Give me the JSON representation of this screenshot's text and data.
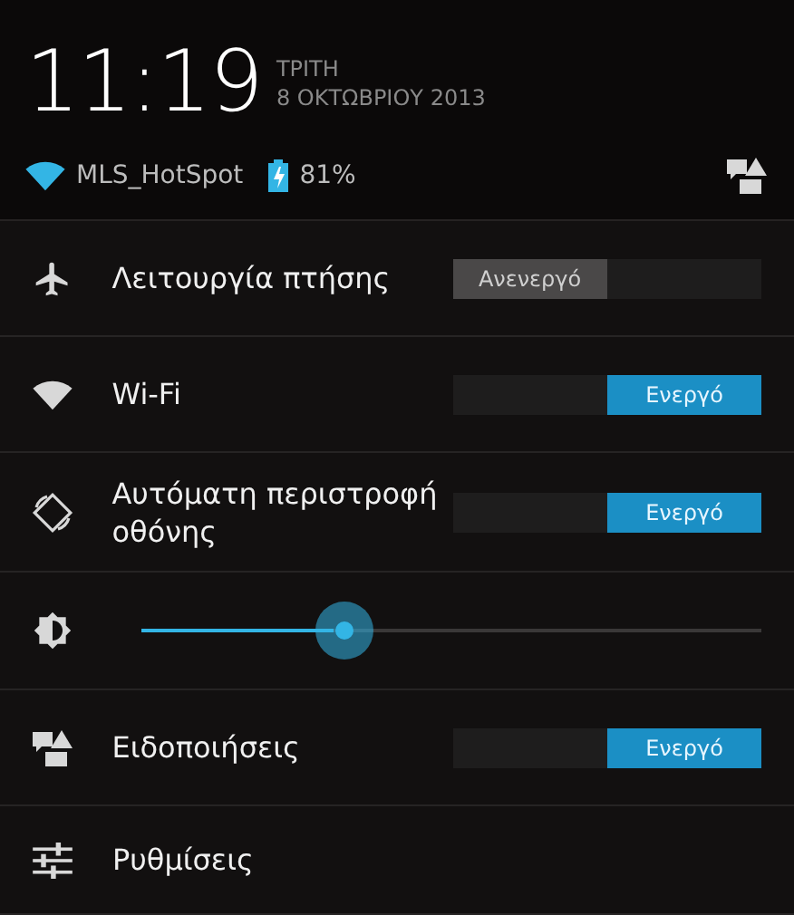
{
  "status": {
    "time": "11:19",
    "day": "ΤΡΙΤΗ",
    "date": "8 ΟΚΤΩΒΡΙΟΥ 2013",
    "network": "MLS_HotSpot",
    "battery": "81%"
  },
  "settings": [
    {
      "kind": "toggle",
      "label": "Λειτουργία πτήσης",
      "on": false,
      "state_text": "Ανενεργό"
    },
    {
      "kind": "toggle",
      "label": "Wi-Fi",
      "on": true,
      "state_text": "Ενεργό"
    },
    {
      "kind": "toggle",
      "label": "Αυτόματη περιστροφή οθόνης",
      "on": true,
      "state_text": "Ενεργό"
    },
    {
      "kind": "slider",
      "level": 0.31
    },
    {
      "kind": "toggle",
      "label": "Ειδοποιήσεις",
      "on": true,
      "state_text": "Ενεργό"
    },
    {
      "kind": "link",
      "label": "Ρυθμίσεις"
    }
  ]
}
